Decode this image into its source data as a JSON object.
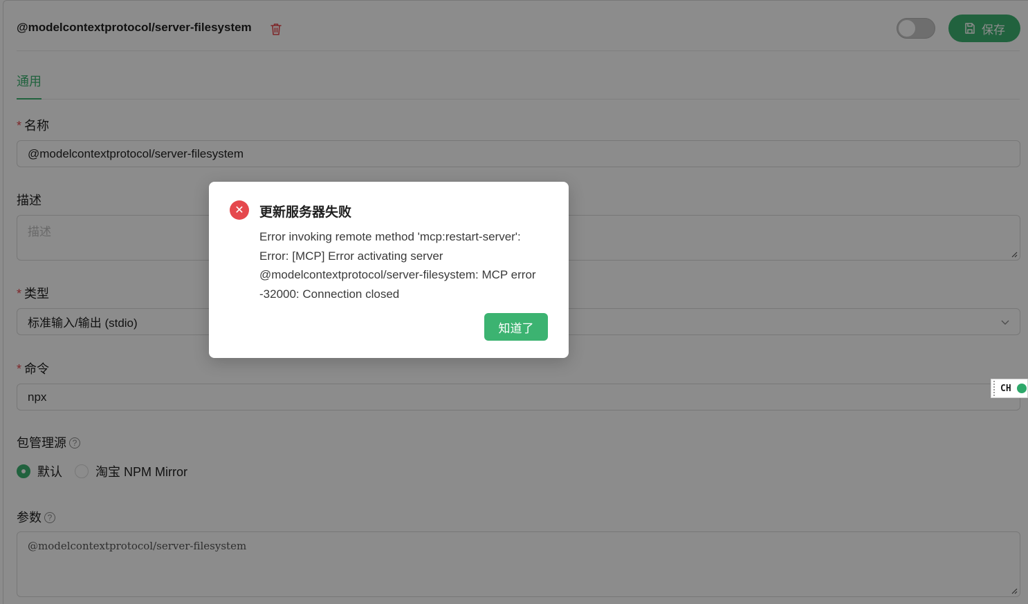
{
  "header": {
    "server_name": "@modelcontextprotocol/server-filesystem",
    "save_label": "保存",
    "enabled": false
  },
  "tabs": [
    {
      "label": "通用",
      "active": true
    }
  ],
  "form": {
    "name": {
      "label": "名称",
      "required": true,
      "value": "@modelcontextprotocol/server-filesystem"
    },
    "description": {
      "label": "描述",
      "required": false,
      "placeholder": "描述",
      "value": ""
    },
    "type": {
      "label": "类型",
      "required": true,
      "value": "标准输入/输出 (stdio)"
    },
    "command": {
      "label": "命令",
      "required": true,
      "value": "npx"
    },
    "registry": {
      "label": "包管理源",
      "options": [
        {
          "label": "默认",
          "selected": true
        },
        {
          "label": "淘宝 NPM Mirror",
          "selected": false
        }
      ]
    },
    "args": {
      "label": "参数",
      "value": "@modelcontextprotocol/server-filesystem"
    }
  },
  "ime": {
    "label": "CH"
  },
  "dialog": {
    "title": "更新服务器失败",
    "message": "Error invoking remote method 'mcp:restart-server': Error: [MCP] Error activating server @modelcontextprotocol/server-filesystem: MCP error -32000: Connection closed",
    "ok_label": "知道了",
    "icon": "error-icon"
  },
  "colors": {
    "accent": "#3cb371",
    "error": "#e5484d"
  }
}
